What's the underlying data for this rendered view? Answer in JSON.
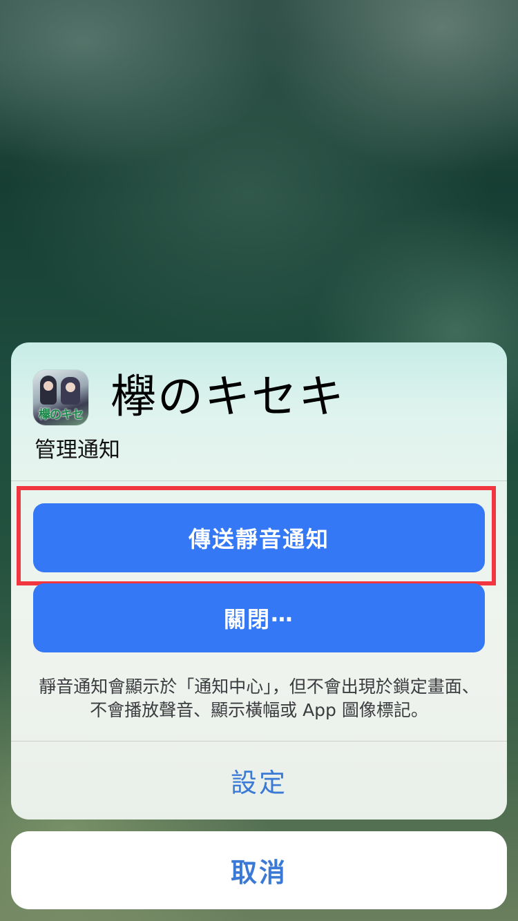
{
  "app": {
    "name": "欅のキセキ",
    "icon": "app-icon-keyakizaka",
    "icon_text": "欅のキセキ"
  },
  "sheet": {
    "subtitle": "管理通知",
    "actions": [
      {
        "label": "傳送靜音通知",
        "highlighted": true
      },
      {
        "label": "關閉⋯"
      }
    ],
    "description": "靜音通知會顯示於「通知中心」，但不會出現於鎖定畫面、不會播放聲音、顯示橫幅或 App 圖像標記。",
    "settings_label": "設定"
  },
  "cancel_label": "取消",
  "colors": {
    "button_blue": "#3478f6",
    "link_blue": "#3b79d6",
    "highlight_red": "#f2363f"
  }
}
